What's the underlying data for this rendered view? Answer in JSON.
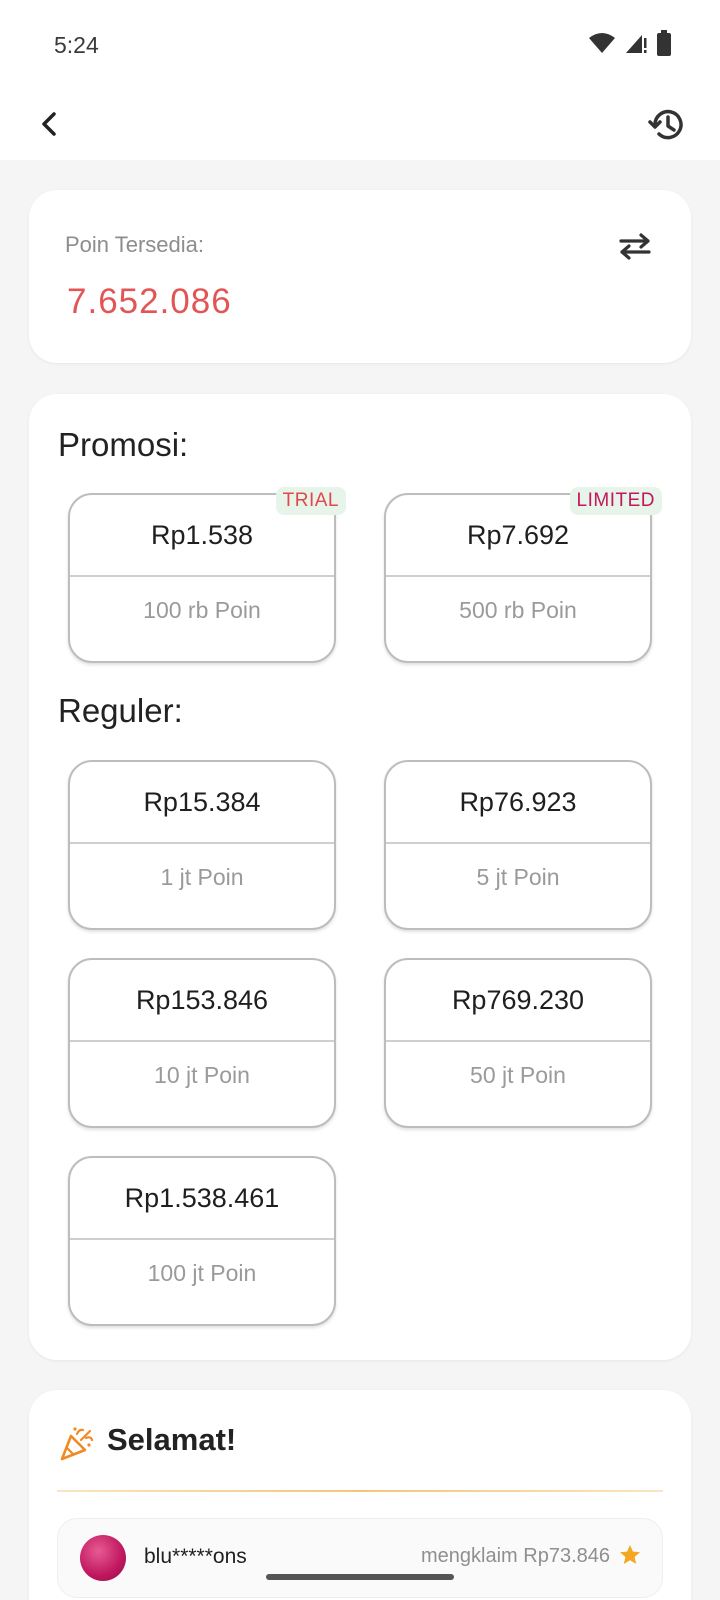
{
  "status_bar": {
    "time": "5:24",
    "icons": [
      "wifi-icon",
      "signal-alert-icon",
      "battery-icon"
    ]
  },
  "app_bar": {
    "back_icon": "chevron-left-icon",
    "history_icon": "history-icon"
  },
  "points": {
    "label": "Poin Tersedia:",
    "value": "7.652.086",
    "swap_icon": "swap-arrows-icon"
  },
  "promo": {
    "title": "Promosi:",
    "items": [
      {
        "price": "Rp1.538",
        "points": "100 rb Poin",
        "badge": "TRIAL"
      },
      {
        "price": "Rp7.692",
        "points": "500 rb Poin",
        "badge": "LIMITED"
      }
    ]
  },
  "reguler": {
    "title": "Reguler:",
    "items": [
      {
        "price": "Rp15.384",
        "points": "1 jt Poin"
      },
      {
        "price": "Rp76.923",
        "points": "5 jt Poin"
      },
      {
        "price": "Rp153.846",
        "points": "10 jt Poin"
      },
      {
        "price": "Rp769.230",
        "points": "50 jt Poin"
      },
      {
        "price": "Rp1.538.461",
        "points": "100 jt Poin"
      }
    ]
  },
  "congrats": {
    "title": "Selamat!",
    "icon": "party-popper-icon",
    "claims": [
      {
        "user": "blu*****ons",
        "text": "mengklaim Rp73.846",
        "icon": "star-icon"
      }
    ]
  },
  "colors": {
    "accent_red": "#e35555",
    "badge_bg": "#e6f4ea",
    "trial_text": "#e2474a",
    "limited_text": "#c2185b",
    "star": "#f5a623"
  }
}
